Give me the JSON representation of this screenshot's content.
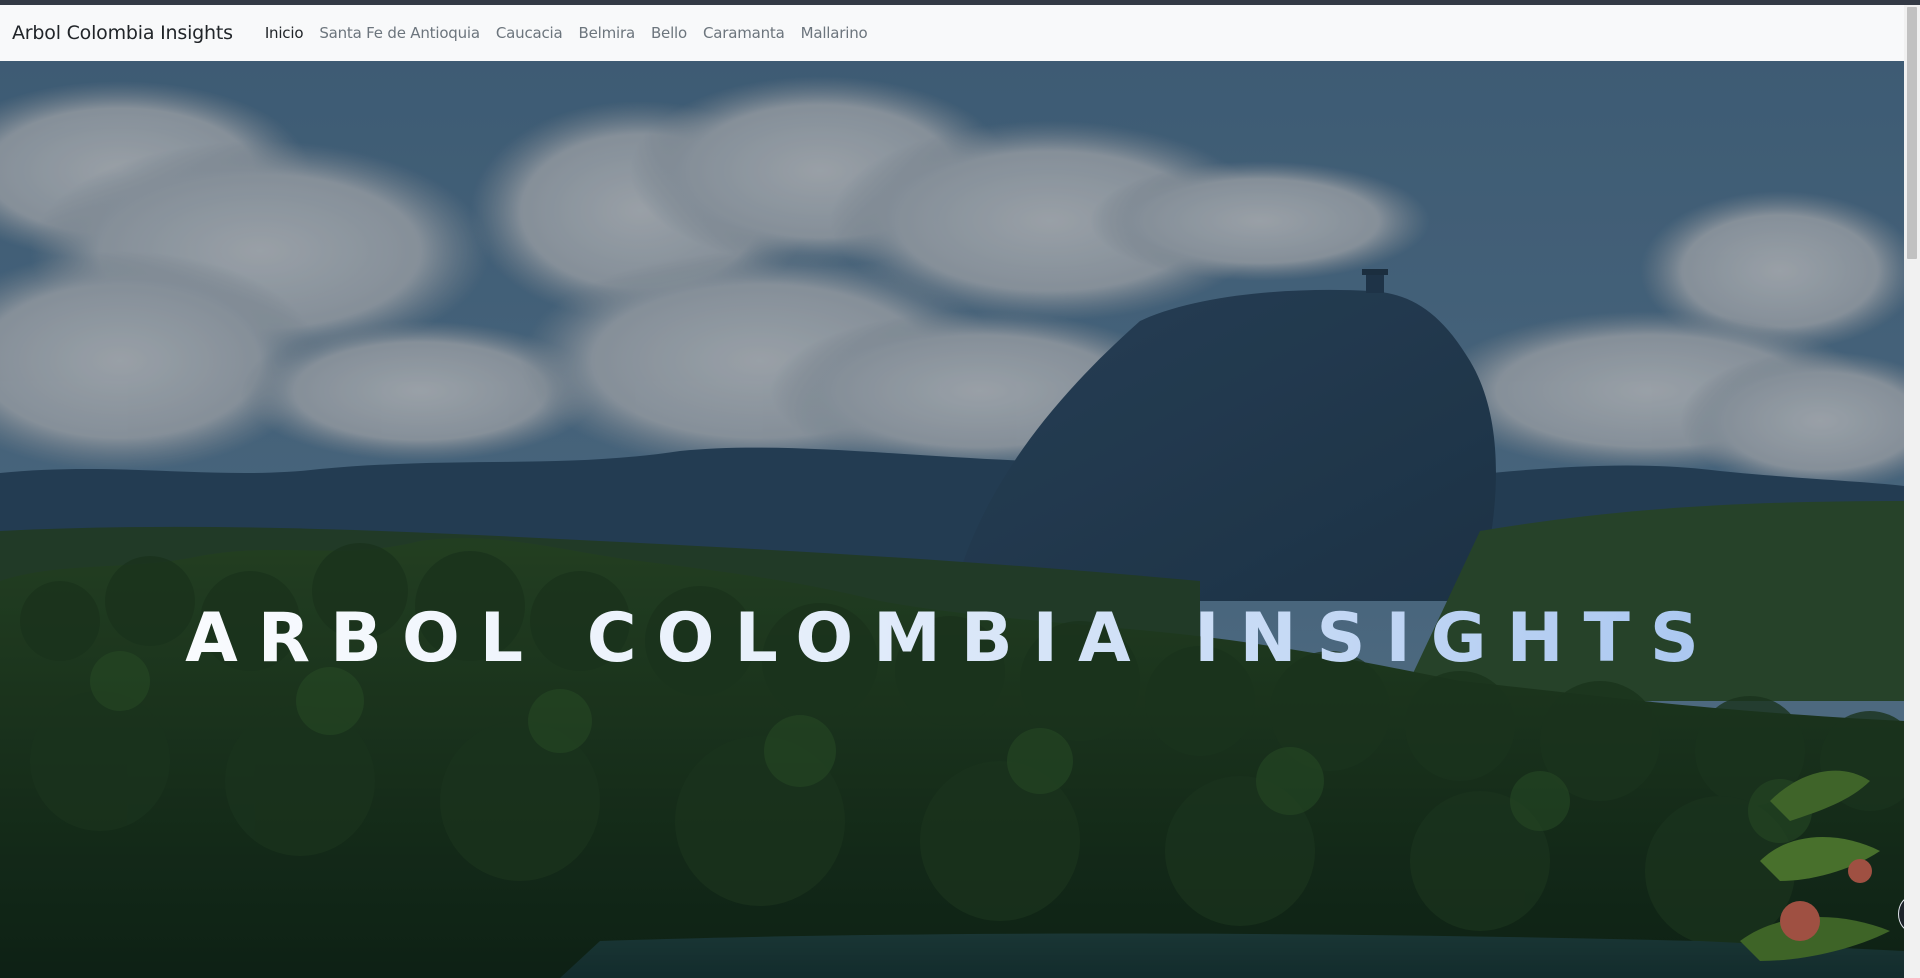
{
  "navbar": {
    "brand": "Arbol Colombia Insights",
    "items": [
      {
        "label": "Inicio",
        "active": true
      },
      {
        "label": "Santa Fe de Antioquia",
        "active": false
      },
      {
        "label": "Caucacia",
        "active": false
      },
      {
        "label": "Belmira",
        "active": false
      },
      {
        "label": "Bello",
        "active": false
      },
      {
        "label": "Caramanta",
        "active": false
      },
      {
        "label": "Mallarino",
        "active": false
      }
    ]
  },
  "hero": {
    "title": "ARBOL COLOMBIA INSIGHTS",
    "image_subject": "El Peñol rock above forest and reservoir, cloudy sky",
    "prev_arrow_icon": "chevron-left-icon"
  },
  "colors": {
    "navbar_bg": "#f8f9fa",
    "top_strip": "#343a45",
    "nav_active": "#212529",
    "nav_inactive": "#6c757d"
  }
}
